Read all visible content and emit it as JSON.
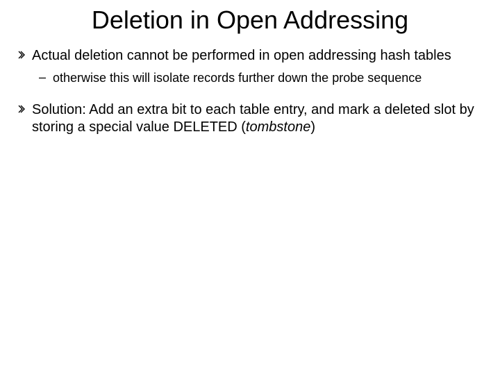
{
  "title": "Deletion in Open Addressing",
  "bullets": [
    {
      "text": "Actual deletion cannot be performed in open addressing hash tables",
      "sub": {
        "text": "otherwise this will isolate records further down the probe sequence"
      }
    },
    {
      "text_pre": "Solution: Add an extra bit to each table entry, and mark a deleted slot by storing a special value DELETED (",
      "text_italic": "tombstone",
      "text_post": ")"
    }
  ],
  "sub_marker": "–"
}
